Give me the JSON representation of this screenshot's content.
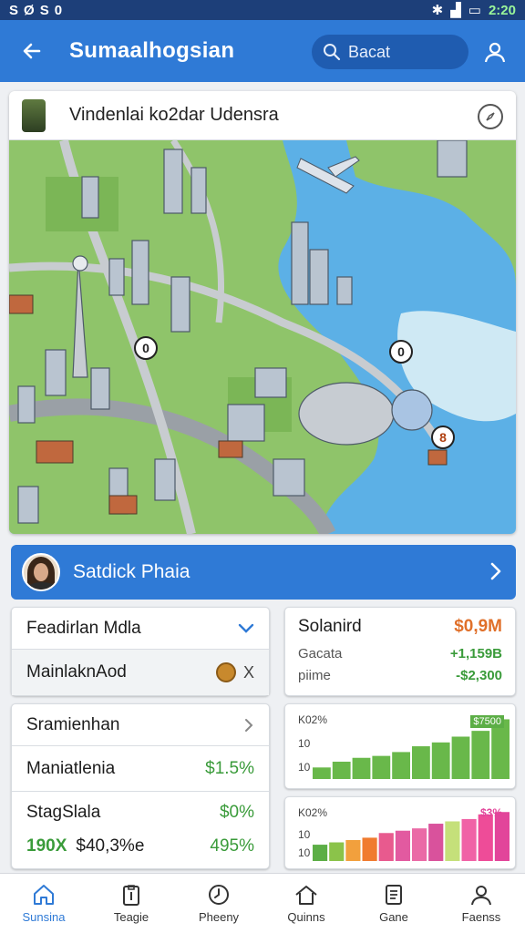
{
  "status_bar": {
    "left_icons": [
      "S",
      "Ø",
      "S",
      "0"
    ],
    "time": "2:20"
  },
  "app_bar": {
    "title": "Sumaalhogsian",
    "search_label": "Bacat"
  },
  "map_card": {
    "title": "Vindenlai ko2dar Udensra",
    "markers": [
      "0",
      "0",
      "8"
    ]
  },
  "profile": {
    "name": "Satdick Phaia"
  },
  "left_panel_top": {
    "select_value": "Feadirlan Mdla",
    "item_label": "MainlaknAod",
    "item_end": "X"
  },
  "stats_panel": {
    "title": "Solanird",
    "title_value": "$0,9M",
    "lines": [
      {
        "label": "Gacata",
        "value": "+1,159B"
      },
      {
        "label": "piime",
        "value": "-$2,300"
      }
    ]
  },
  "left_panel_bottom": {
    "rows": [
      {
        "label": "Sramienhan",
        "value": ""
      },
      {
        "label": "Maniatlenia",
        "value": "$1.5%"
      },
      {
        "label": "StagSlala",
        "value": "$0%"
      }
    ],
    "footer_left": "190X",
    "footer_mid": "$40,3%e",
    "footer_right": "495%"
  },
  "chart_top": {
    "ylabel_top": "K02%",
    "ylabel_mid": "10",
    "ylabel_low": "10",
    "highlight_label": "$7500"
  },
  "chart_bottom": {
    "ylabel_top": "K02%",
    "ylabel_mid": "10",
    "ylabel_low": "10",
    "highlight_label": "$3%"
  },
  "chart_data": [
    {
      "type": "bar",
      "categories": [
        "1",
        "2",
        "3",
        "4",
        "5",
        "6",
        "7",
        "8",
        "9",
        "10"
      ],
      "values": [
        12,
        18,
        22,
        24,
        28,
        34,
        38,
        44,
        50,
        62
      ],
      "ylim": [
        0,
        70
      ],
      "colors": [
        "#69b84a"
      ],
      "grid": false
    },
    {
      "type": "bar",
      "categories": [
        "1",
        "2",
        "3",
        "4",
        "5",
        "6",
        "7",
        "8",
        "9",
        "10",
        "11",
        "12"
      ],
      "values": [
        14,
        16,
        18,
        20,
        24,
        26,
        28,
        32,
        34,
        36,
        40,
        42
      ],
      "ylim": [
        0,
        50
      ],
      "colors": [
        "#5cae46",
        "#8bc34a",
        "#f2a03d",
        "#f07b2f",
        "#e85a8e",
        "#e25aa0",
        "#ea6aa6",
        "#d9529c",
        "#c5e07a",
        "#f062a6",
        "#ee4c98",
        "#e2459a"
      ],
      "grid": false
    }
  ],
  "bottom_nav": [
    {
      "label": "Sunsina",
      "icon": "home-icon"
    },
    {
      "label": "Teagie",
      "icon": "clipboard-icon"
    },
    {
      "label": "Pheeny",
      "icon": "clock-icon"
    },
    {
      "label": "Quinns",
      "icon": "house-icon"
    },
    {
      "label": "Gane",
      "icon": "list-icon"
    },
    {
      "label": "Faenss",
      "icon": "person-icon"
    }
  ],
  "colors": {
    "accent": "#2f7ad6",
    "positive": "#3a9b3a",
    "negative": "#e0702a"
  }
}
